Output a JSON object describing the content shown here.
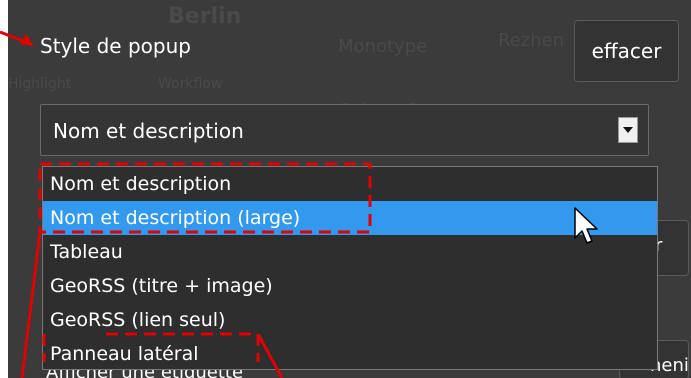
{
  "panel": {
    "style_label": "Style de popup",
    "clear_button": "effacer"
  },
  "select": {
    "value": "Nom et description"
  },
  "dropdown": {
    "options": [
      "Nom et description",
      "Nom et description (large)",
      "Tableau",
      "GeoRSS (titre + image)",
      "GeoRSS (lien seul)",
      "Panneau latéral"
    ],
    "highlighted_index": 1
  },
  "side_buttons": {
    "b1": "ir",
    "b2": "nenir"
  },
  "bottom": {
    "left_text": "Afficher une étiquette"
  },
  "colors": {
    "panel_bg": "#3b3b3b",
    "selected_bg": "#3399ee",
    "annotation_red": "#e00000"
  },
  "icons": {
    "cursor": "mouse-pointer-icon",
    "dropdown_arrow": "caret-down-icon"
  }
}
